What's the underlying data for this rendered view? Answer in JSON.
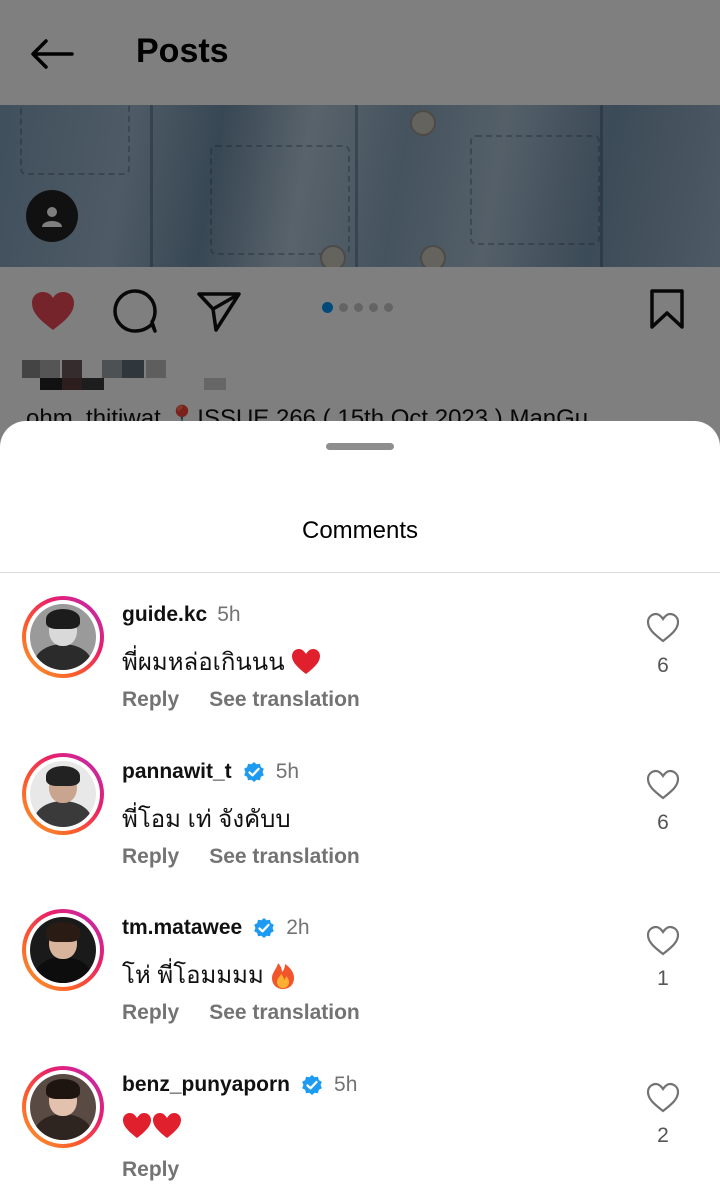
{
  "header": {
    "title": "Posts"
  },
  "post": {
    "caption_peek": "ohm_thitiwat 📍ISSUE 266 ( 15th Oct 2023 ) ManGu",
    "carousel": {
      "total": 5,
      "active_index": 0
    }
  },
  "sheet": {
    "title": "Comments"
  },
  "comments": [
    {
      "username": "guide.kc",
      "verified": false,
      "time": "5h",
      "text": "พี่ผมหล่อเกินนน",
      "emoji": "red-heart",
      "reply_label": "Reply",
      "translate_label": "See translation",
      "likes": "6"
    },
    {
      "username": "pannawit_t",
      "verified": true,
      "time": "5h",
      "text": "พี่โอม เท่ จังคับบ",
      "emoji": "",
      "reply_label": "Reply",
      "translate_label": "See translation",
      "likes": "6"
    },
    {
      "username": "tm.matawee",
      "verified": true,
      "time": "2h",
      "text": "โห่ พี่โอมมมม",
      "emoji": "fire",
      "reply_label": "Reply",
      "translate_label": "See translation",
      "likes": "1"
    },
    {
      "username": "benz_punyaporn",
      "verified": true,
      "time": "5h",
      "text": "",
      "emoji": "two-red-hearts",
      "reply_label": "Reply",
      "translate_label": "",
      "likes": "2"
    }
  ],
  "colors": {
    "accent": "#0095f6",
    "like_red": "#ed4956",
    "verified_blue": "#1d9bf0",
    "secondary_text": "#737373"
  }
}
